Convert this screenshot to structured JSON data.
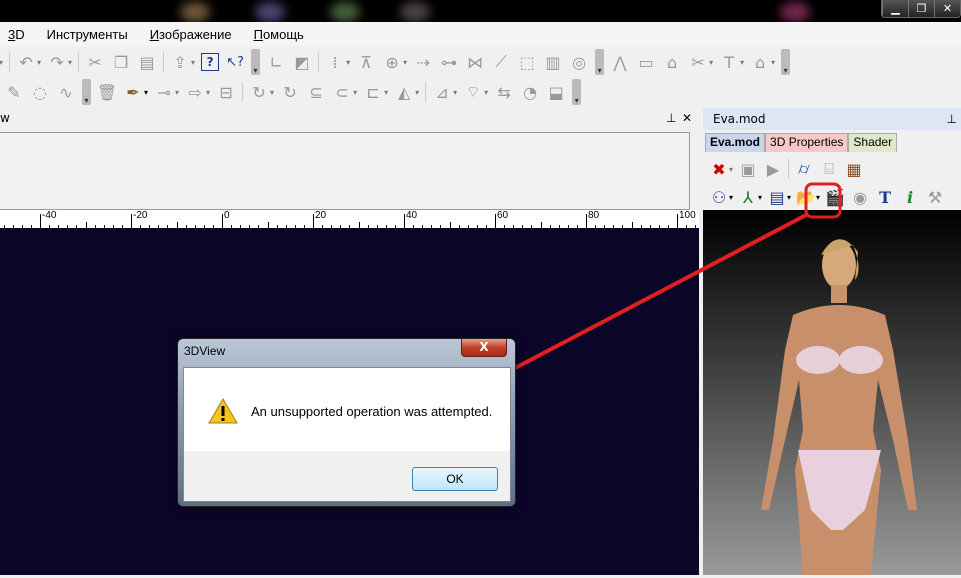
{
  "window_controls": {
    "minimize": "▁",
    "restore": "❐",
    "close": "✕"
  },
  "menu": [
    {
      "label": "3D",
      "u": "3",
      "rest": "D"
    },
    {
      "label": "Инструменты",
      "u": "",
      "rest": "Инструменты"
    },
    {
      "label": "Изображение",
      "u": "И",
      "rest": "зображение"
    },
    {
      "label": "Помощь",
      "u": "П",
      "rest": "омощь"
    }
  ],
  "left_panel": {
    "title": "w",
    "ruler_ticks": [
      "-40",
      "-20",
      "0",
      "20",
      "40",
      "60",
      "80",
      "100"
    ]
  },
  "right_panel": {
    "title": "Eva.mod",
    "tabs": [
      "Eva.mod",
      "3D Properties",
      "Shader"
    ]
  },
  "dialog": {
    "title": "3DView",
    "close": "X",
    "message": "An unsupported operation was attempted.",
    "ok": "OK"
  },
  "colors": {
    "canvas": "#0b0528",
    "annotation": "#e02020"
  }
}
